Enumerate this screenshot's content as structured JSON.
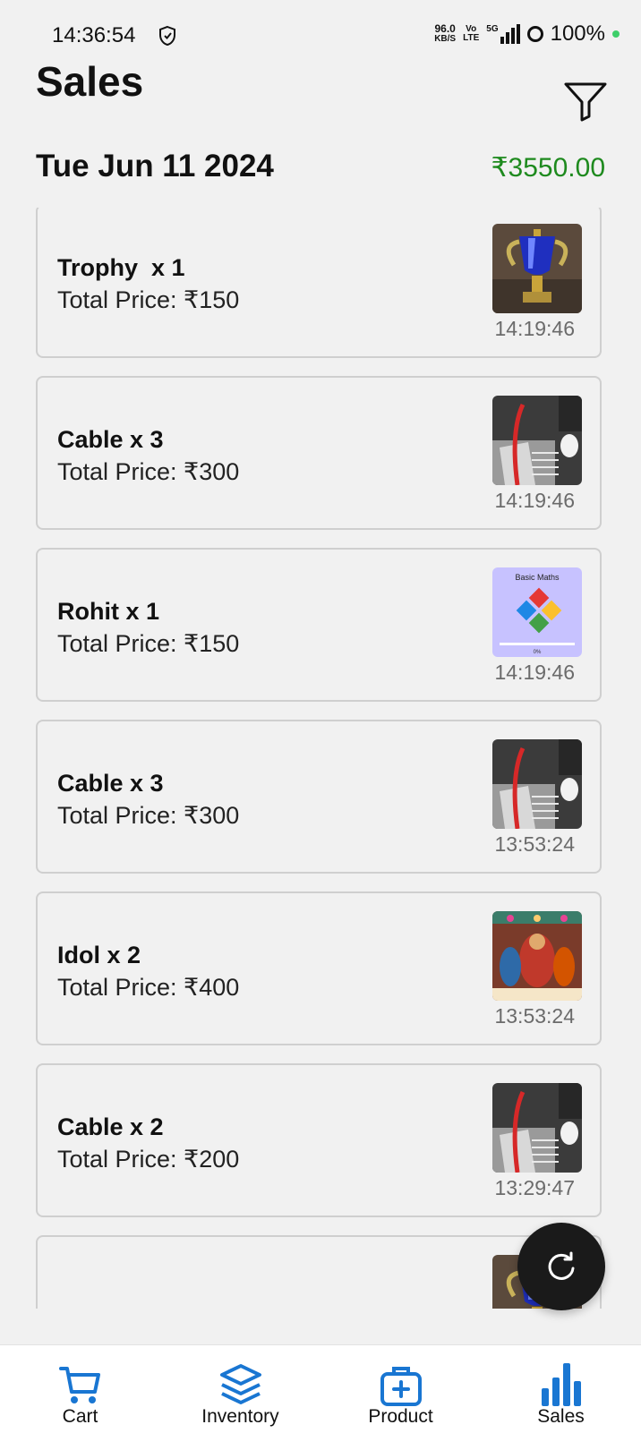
{
  "status_bar": {
    "time": "14:36:54",
    "net_speed": "96.0",
    "net_unit": "KB/S",
    "volte_top": "Vo",
    "volte_bottom": "LTE",
    "network": "5G",
    "battery": "100%"
  },
  "header": {
    "title": "Sales",
    "filter_icon": "filter-funnel-icon"
  },
  "date_group": {
    "date": "Tue Jun 11 2024",
    "total": "₹3550.00",
    "total_color": "#1e8a1e"
  },
  "sales": [
    {
      "title": "Trophy  x 1",
      "price": "Total Price: ₹150",
      "time": "14:19:46",
      "image": "trophy"
    },
    {
      "title": "Cable x 3",
      "price": "Total Price: ₹300",
      "time": "14:19:46",
      "image": "cable"
    },
    {
      "title": "Rohit x 1",
      "price": "Total Price: ₹150",
      "time": "14:19:46",
      "image": "maths",
      "image_caption": "Basic Maths",
      "image_progress": "0%"
    },
    {
      "title": "Cable x 3",
      "price": "Total Price: ₹300",
      "time": "13:53:24",
      "image": "cable"
    },
    {
      "title": "Idol x 2",
      "price": "Total Price: ₹400",
      "time": "13:53:24",
      "image": "idol"
    },
    {
      "title": "Cable x 2",
      "price": "Total Price: ₹200",
      "time": "13:29:47",
      "image": "cable"
    },
    {
      "title": "",
      "price": "",
      "time": "",
      "image": "trophy"
    }
  ],
  "fab": {
    "icon": "refresh-icon"
  },
  "bottom_nav": {
    "accent": "#1976d2",
    "items": [
      {
        "label": "Cart",
        "icon": "cart-icon"
      },
      {
        "label": "Inventory",
        "icon": "layers-icon"
      },
      {
        "label": "Product",
        "icon": "medkit-icon"
      },
      {
        "label": "Sales",
        "icon": "bar-chart-icon",
        "active": true
      }
    ]
  }
}
